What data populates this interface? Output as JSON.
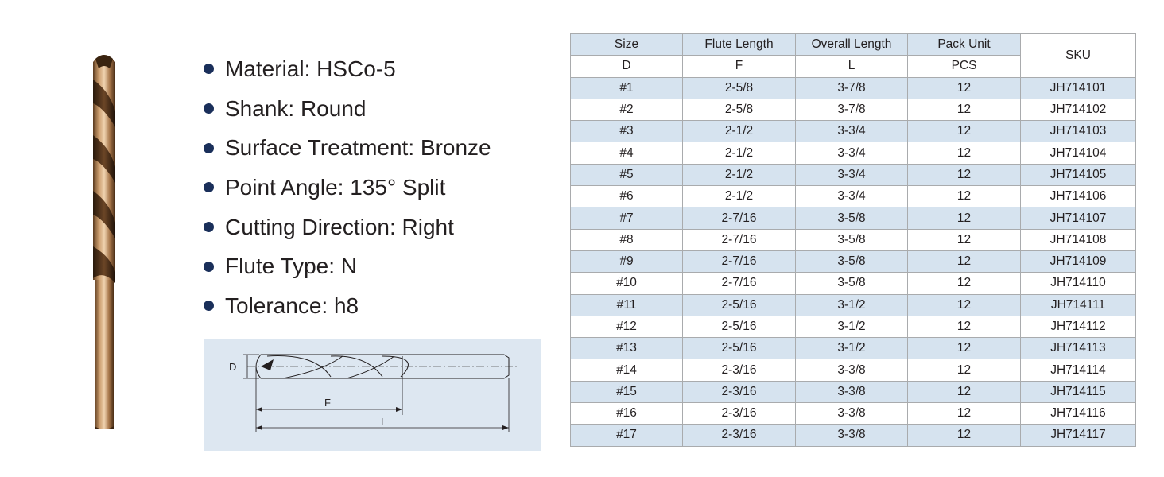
{
  "specs": [
    {
      "text": "Material: HSCo-5"
    },
    {
      "text": "Shank: Round"
    },
    {
      "text": "Surface Treatment: Bronze"
    },
    {
      "text": "Point Angle: 135° Split"
    },
    {
      "text": "Cutting Direction: Right"
    },
    {
      "text": "Flute Type: N"
    },
    {
      "text": "Tolerance: h8"
    }
  ],
  "diagram": {
    "label_d": "D",
    "label_f": "F",
    "label_l": "L"
  },
  "table": {
    "headers": [
      "Size",
      "Flute Length",
      "Overall Length",
      "Pack Unit",
      "SKU"
    ],
    "subheaders": [
      "D",
      "F",
      "L",
      "PCS"
    ],
    "rows": [
      [
        "#1",
        "2-5/8",
        "3-7/8",
        "12",
        "JH714101"
      ],
      [
        "#2",
        "2-5/8",
        "3-7/8",
        "12",
        "JH714102"
      ],
      [
        "#3",
        "2-1/2",
        "3-3/4",
        "12",
        "JH714103"
      ],
      [
        "#4",
        "2-1/2",
        "3-3/4",
        "12",
        "JH714104"
      ],
      [
        "#5",
        "2-1/2",
        "3-3/4",
        "12",
        "JH714105"
      ],
      [
        "#6",
        "2-1/2",
        "3-3/4",
        "12",
        "JH714106"
      ],
      [
        "#7",
        "2-7/16",
        "3-5/8",
        "12",
        "JH714107"
      ],
      [
        "#8",
        "2-7/16",
        "3-5/8",
        "12",
        "JH714108"
      ],
      [
        "#9",
        "2-7/16",
        "3-5/8",
        "12",
        "JH714109"
      ],
      [
        "#10",
        "2-7/16",
        "3-5/8",
        "12",
        "JH714110"
      ],
      [
        "#11",
        "2-5/16",
        "3-1/2",
        "12",
        "JH714111"
      ],
      [
        "#12",
        "2-5/16",
        "3-1/2",
        "12",
        "JH714112"
      ],
      [
        "#13",
        "2-5/16",
        "3-1/2",
        "12",
        "JH714113"
      ],
      [
        "#14",
        "2-3/16",
        "3-3/8",
        "12",
        "JH714114"
      ],
      [
        "#15",
        "2-3/16",
        "3-3/8",
        "12",
        "JH714115"
      ],
      [
        "#16",
        "2-3/16",
        "3-3/8",
        "12",
        "JH714116"
      ],
      [
        "#17",
        "2-3/16",
        "3-3/8",
        "12",
        "JH714117"
      ]
    ]
  },
  "colors": {
    "bullet": "#1a2f5a",
    "table_shade": "#d6e3ef",
    "diagram_bg": "#dde7f1",
    "bronze": "#9b6a3c"
  }
}
